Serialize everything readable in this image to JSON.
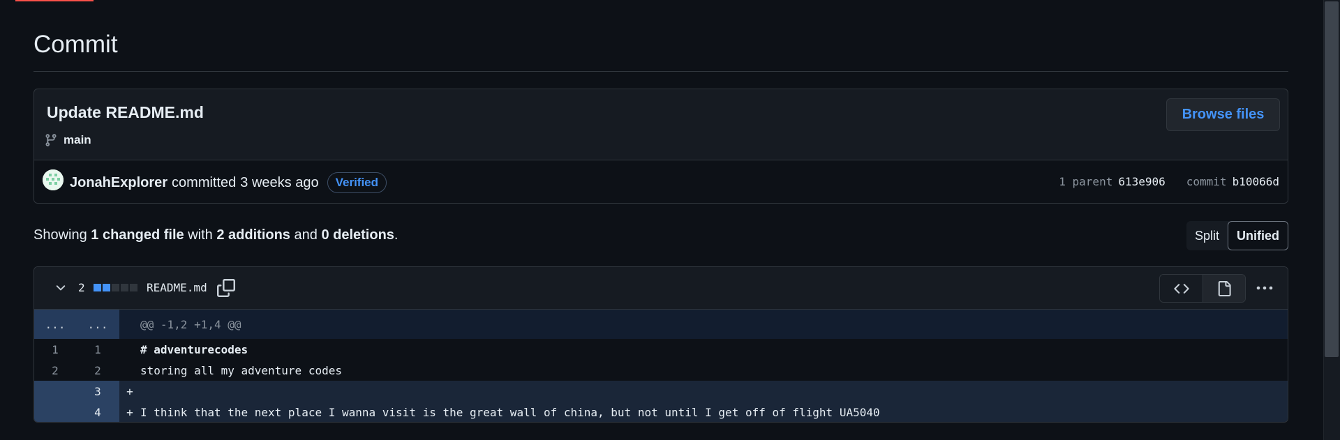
{
  "page": {
    "title": "Commit"
  },
  "commit": {
    "message": "Update README.md",
    "branch": "main",
    "browse_label": "Browse files",
    "author": "JonahExplorer",
    "action": "committed",
    "time": "3 weeks ago",
    "verified_label": "Verified",
    "parent_label": "1 parent",
    "parent_sha": "613e906",
    "commit_label": "commit",
    "commit_sha": "b10066d"
  },
  "summary": {
    "showing": "Showing",
    "changed": "1 changed file",
    "with": "with",
    "additions": "2 additions",
    "and": "and",
    "deletions": "0 deletions",
    "period": "."
  },
  "view_toggle": {
    "split": "Split",
    "unified": "Unified",
    "selected": "Unified"
  },
  "diff": {
    "count": "2",
    "diffstat": {
      "additions_blocks": 2,
      "total_blocks": 5
    },
    "filename": "README.md",
    "hunk": {
      "old_ln": "...",
      "new_ln": "...",
      "header": "@@ -1,2 +1,4 @@"
    },
    "lines": [
      {
        "type": "context",
        "old": "1",
        "new": "1",
        "marker": "",
        "text": "# adventurecodes"
      },
      {
        "type": "context",
        "old": "2",
        "new": "2",
        "marker": "",
        "text": "storing all my adventure codes"
      },
      {
        "type": "add",
        "old": "",
        "new": "3",
        "marker": "+",
        "text": ""
      },
      {
        "type": "add",
        "old": "",
        "new": "4",
        "marker": "+",
        "text": "I think that the next place I wanna visit is the great wall of china, but not until I get off of flight UA5040"
      }
    ]
  },
  "colors": {
    "accent": "#4493f8",
    "background": "#0d1117",
    "panel": "#161b22",
    "add_bg": "#1a2638"
  },
  "icons": [
    "git-branch-icon",
    "avatar",
    "chevron-down-icon",
    "copy-icon",
    "code-icon",
    "file-icon",
    "kebab-horizontal-icon"
  ]
}
